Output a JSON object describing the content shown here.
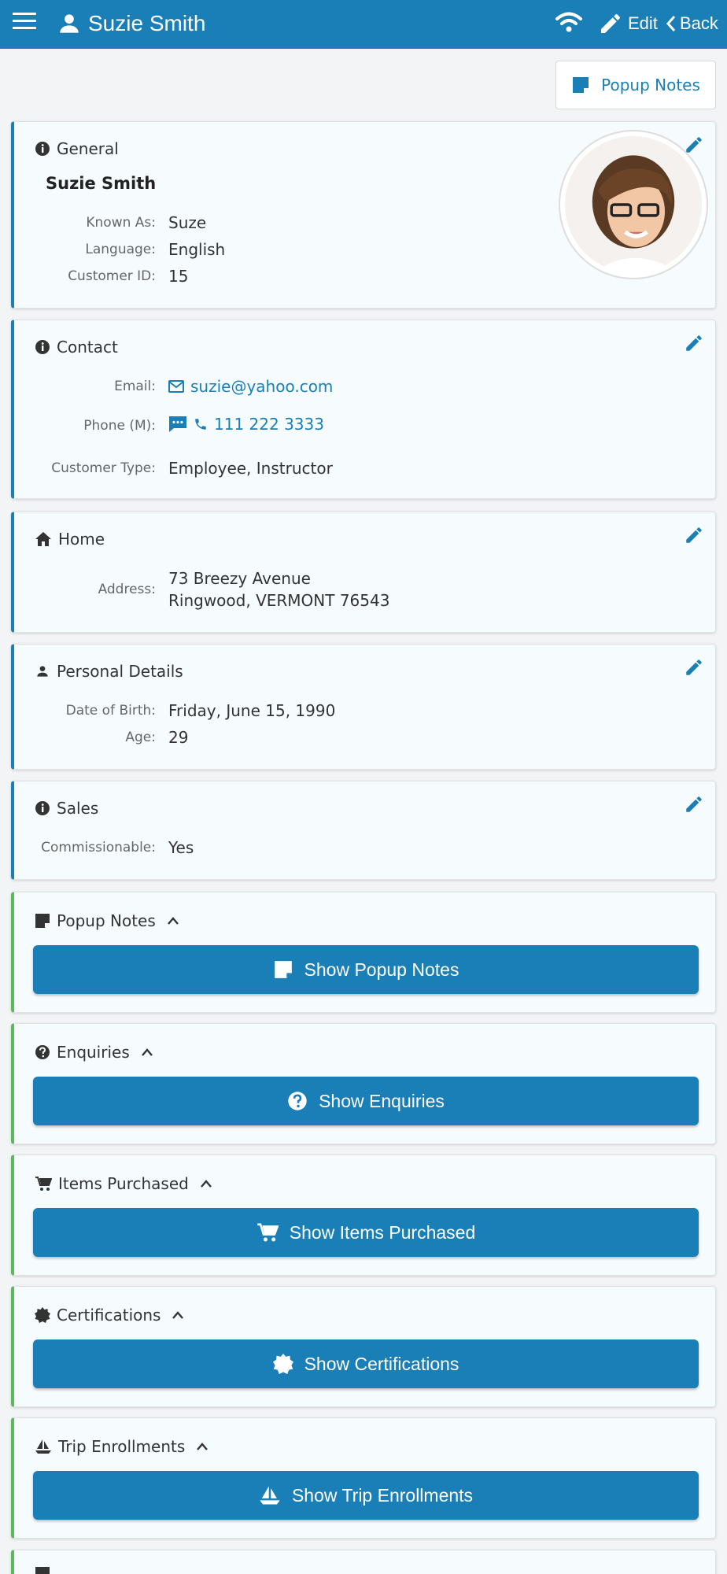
{
  "header": {
    "title": "Suzie Smith",
    "edit_label": "Edit",
    "back_label": "Back"
  },
  "popup_notes_button": "Popup Notes",
  "general": {
    "title": "General",
    "name": "Suzie Smith",
    "known_as_label": "Known As:",
    "known_as": "Suze",
    "language_label": "Language:",
    "language": "English",
    "customer_id_label": "Customer ID:",
    "customer_id": "15"
  },
  "contact": {
    "title": "Contact",
    "email_label": "Email:",
    "email": "suzie@yahoo.com",
    "phone_label": "Phone (M):",
    "phone": "111 222 3333",
    "type_label": "Customer Type:",
    "type": "Employee, Instructor"
  },
  "home": {
    "title": "Home",
    "address_label": "Address:",
    "address_line1": "73 Breezy Avenue",
    "address_line2": "Ringwood, VERMONT 76543"
  },
  "personal": {
    "title": "Personal Details",
    "dob_label": "Date of Birth:",
    "dob": "Friday, June 15, 1990",
    "age_label": "Age:",
    "age": "29"
  },
  "sales": {
    "title": "Sales",
    "commission_label": "Commissionable:",
    "commission": "Yes"
  },
  "sections": [
    {
      "title": "Popup Notes",
      "button": "Show Popup Notes",
      "icon": "note-icon"
    },
    {
      "title": "Enquiries",
      "button": "Show Enquiries",
      "icon": "question-icon"
    },
    {
      "title": "Items Purchased",
      "button": "Show Items Purchased",
      "icon": "cart-icon"
    },
    {
      "title": "Certifications",
      "button": "Show Certifications",
      "icon": "certificate-icon"
    },
    {
      "title": "Trip Enrollments",
      "button": "Show Trip Enrollments",
      "icon": "boat-icon"
    }
  ],
  "colors": {
    "primary": "#1a7fb6",
    "accent_green": "#5cb85c",
    "card_bg": "#f6fbfd"
  }
}
